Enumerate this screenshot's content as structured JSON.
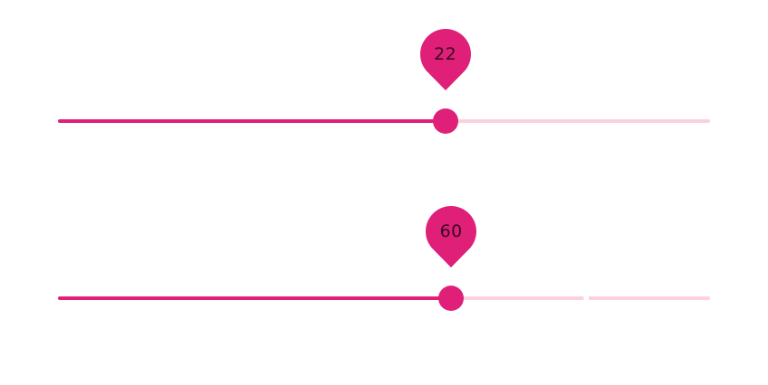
{
  "sliders": [
    {
      "value": "22",
      "fill_fraction": 0.594
    },
    {
      "value": "60",
      "fill_fraction": 0.603
    }
  ],
  "colors": {
    "accent": "#df1f78",
    "track_inactive": "#fbd0df",
    "label_text": "#3a0a22"
  }
}
